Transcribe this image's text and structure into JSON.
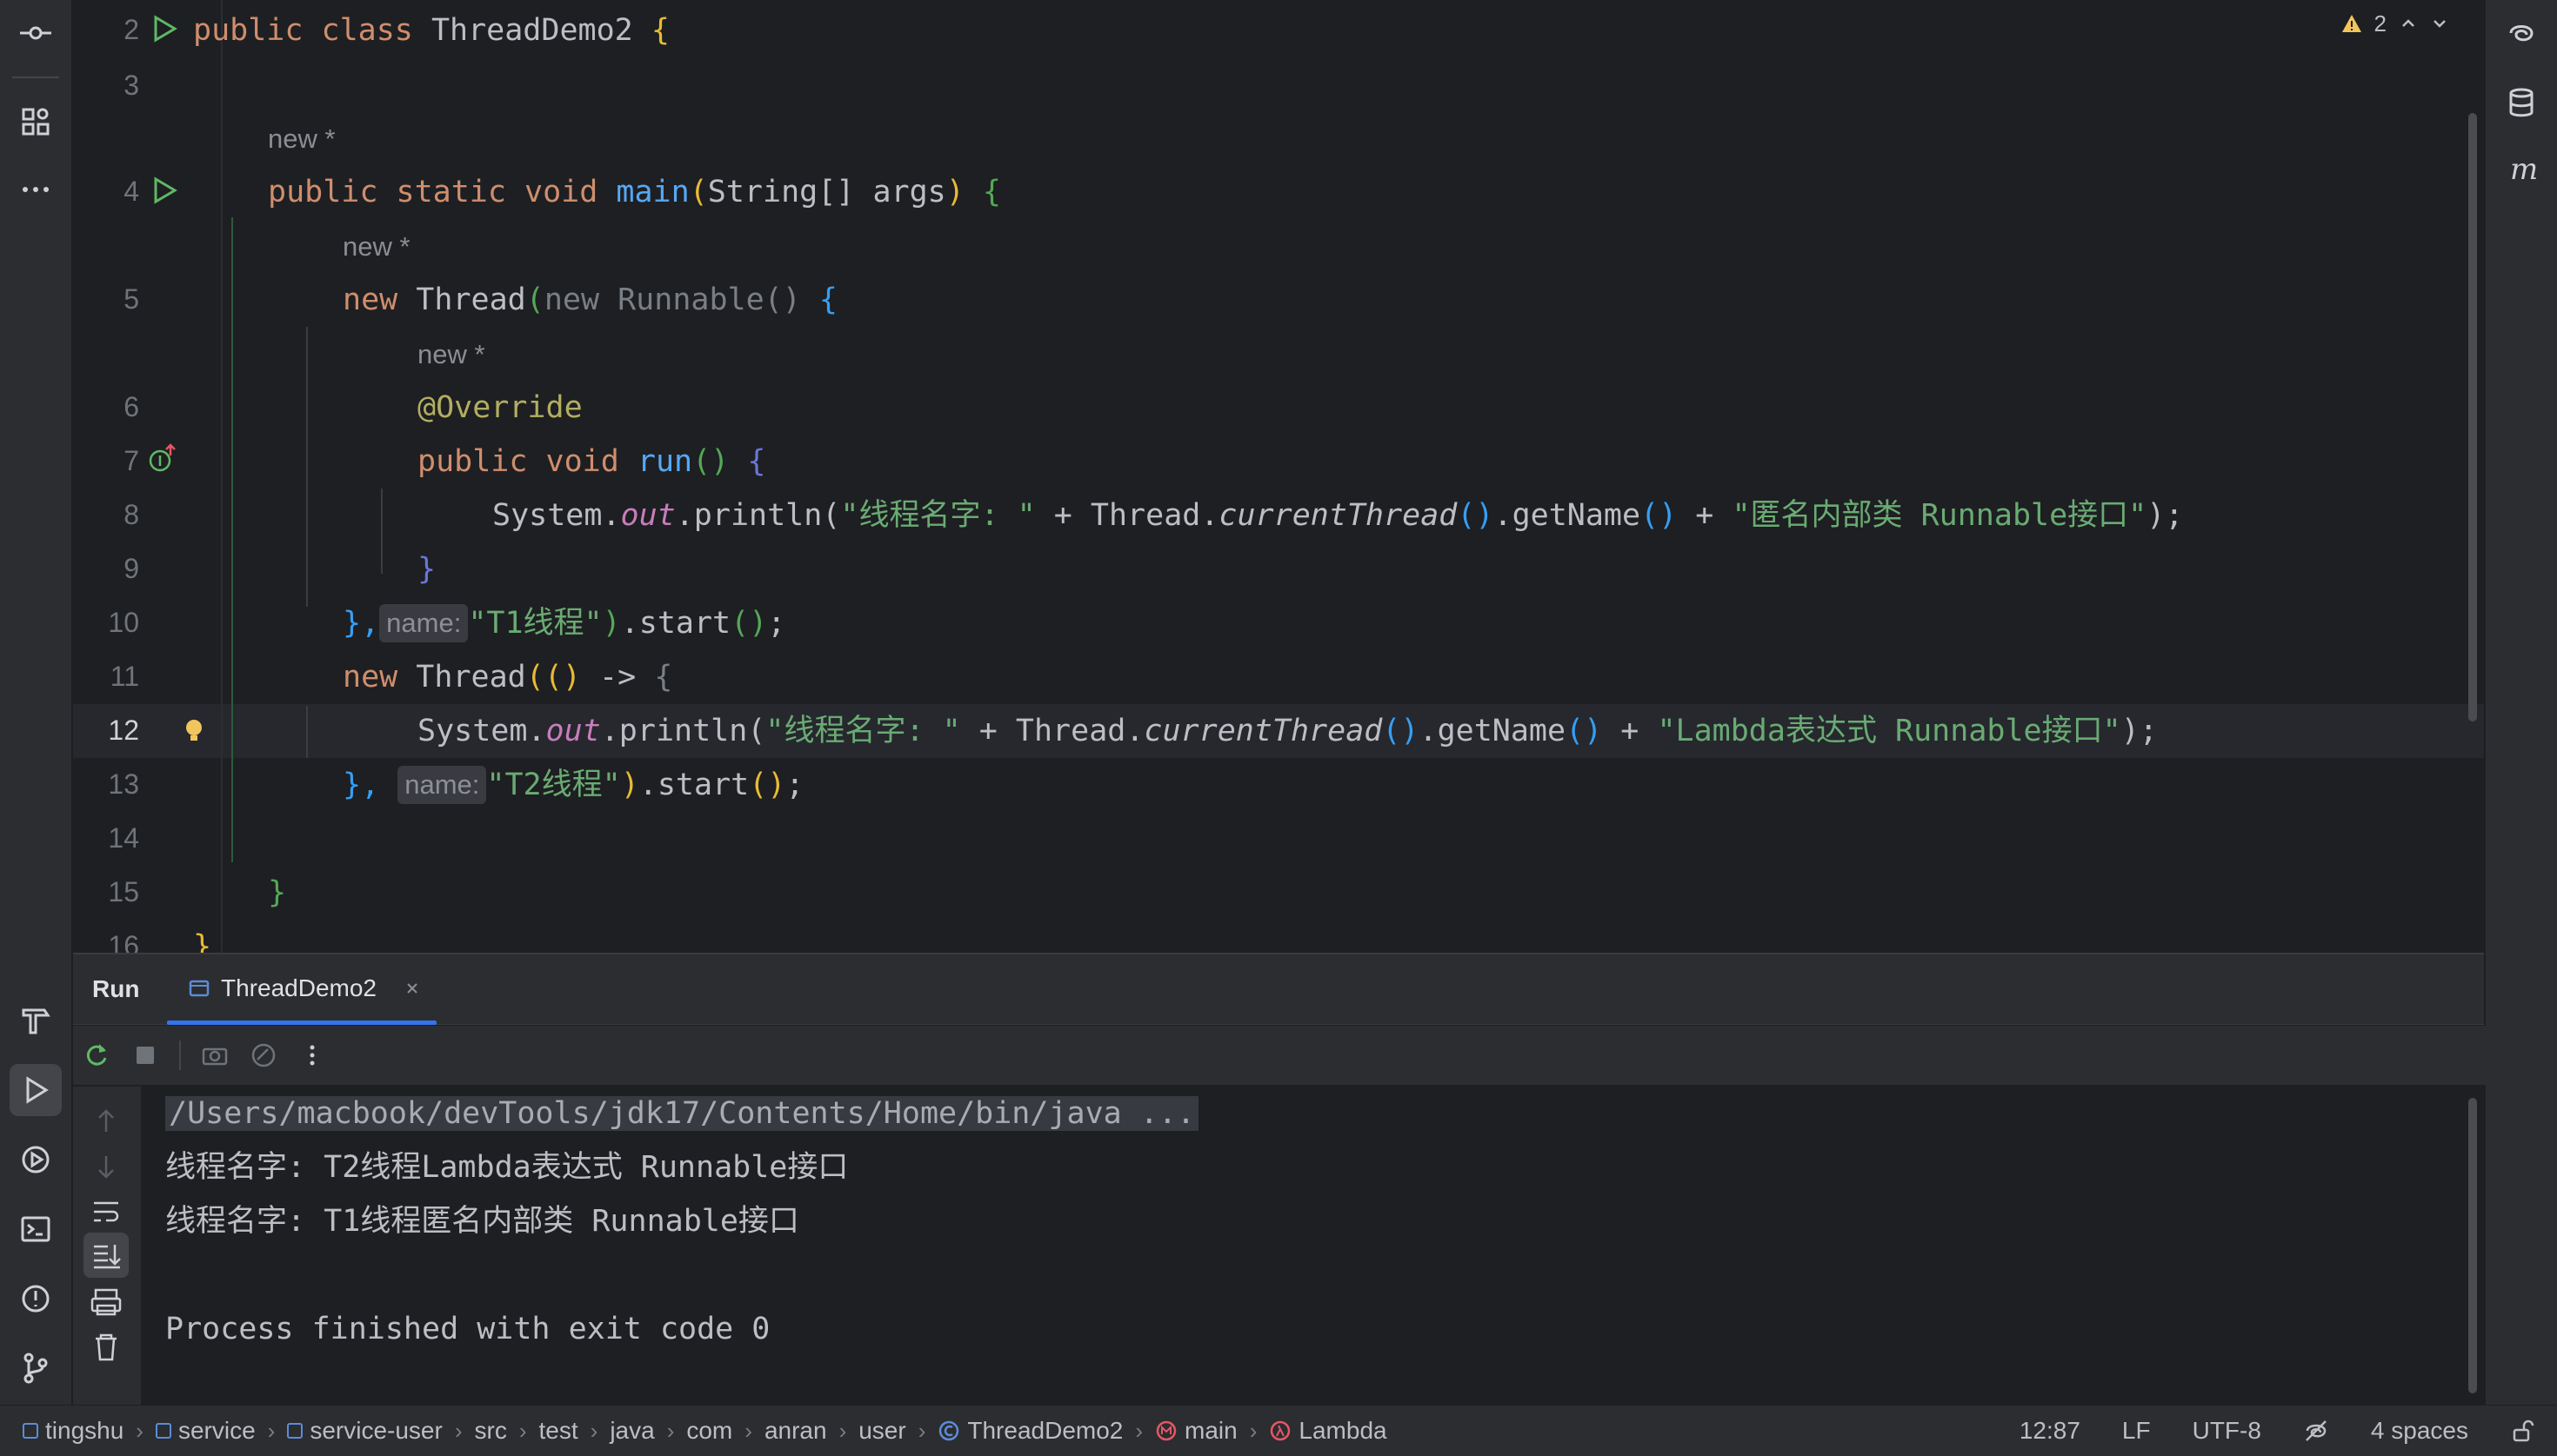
{
  "editor": {
    "line_numbers": [
      "2",
      "3",
      "4",
      "5",
      "6",
      "7",
      "8",
      "9",
      "10",
      "11",
      "12",
      "13",
      "14",
      "15",
      "16"
    ],
    "hints": {
      "new_star": "new *"
    },
    "param_hints": {
      "name": "name:"
    },
    "code": {
      "l2": {
        "k1": "public",
        "k2": "class",
        "name": "ThreadDemo2",
        "brace": "{"
      },
      "l4": {
        "k1": "public",
        "k2": "static",
        "k3": "void",
        "fn": "main",
        "p_open": "(",
        "type": "String[]",
        "arg": "args",
        "p_close": ")",
        "brace": "{"
      },
      "l5": {
        "k": "new",
        "cls": "Thread",
        "p_open": "(",
        "grey": "new Runnable()",
        "brace": "{"
      },
      "l6": {
        "an": "@Override"
      },
      "l7": {
        "k1": "public",
        "k2": "void",
        "fn": "run",
        "parens": "()",
        "brace": "{"
      },
      "l8": {
        "obj": "System.",
        "field": "out",
        "call": ".println(",
        "s1": "\"线程名字: \"",
        "plus1": " + Thread.",
        "m": "currentThread",
        "paren1": "()",
        "getname": ".getName",
        "paren2": "()",
        "plus2": " + ",
        "s2": "\"匿名内部类 Runnable接口\"",
        "end": ");"
      },
      "l9": {
        "brace": "}"
      },
      "l10": {
        "brace": "},",
        "s": "\"T1线程\"",
        "close": ")",
        "start": ".start",
        "paren": "()",
        "semi": ";"
      },
      "l11": {
        "k": "new",
        "cls": "Thread",
        "p_open": "(",
        "lp": "()",
        "arrow": " -> ",
        "brace": "{"
      },
      "l12": {
        "obj": "System.",
        "field": "out",
        "call": ".println(",
        "s1": "\"线程名字: \"",
        "plus1": " + Thread.",
        "m": "currentThread",
        "paren1": "()",
        "getname": ".getName",
        "paren2": "()",
        "plus2": " + ",
        "s2": "\"Lambda表达式 Runnable接口\"",
        "end": ");"
      },
      "l13": {
        "brace": "},",
        "s": "\"T2线程\"",
        "close": ")",
        "start": ".start",
        "paren": "()",
        "semi": ";"
      },
      "l15": {
        "brace": "}"
      },
      "l16": {
        "brace": "}"
      }
    },
    "inspection": {
      "warnings": "2"
    }
  },
  "run_panel": {
    "title": "Run",
    "tab_label": "ThreadDemo2",
    "console": [
      "/Users/macbook/devTools/jdk17/Contents/Home/bin/java ...",
      "线程名字: T2线程Lambda表达式 Runnable接口",
      "线程名字: T1线程匿名内部类 Runnable接口",
      "",
      "Process finished with exit code 0"
    ]
  },
  "statusbar": {
    "breadcrumbs": [
      "tingshu",
      "service",
      "service-user",
      "src",
      "test",
      "java",
      "com",
      "anran",
      "user",
      "ThreadDemo2",
      "main",
      "Lambda"
    ],
    "position": "12:87",
    "line_sep": "LF",
    "encoding": "UTF-8",
    "indent": "4 spaces"
  },
  "colors": {
    "keyword": "#cf8e6d",
    "function": "#56a8f5",
    "string": "#6aab73",
    "annotation": "#b3ae60",
    "static_field": "#c77dbb",
    "accent": "#3574f0"
  }
}
